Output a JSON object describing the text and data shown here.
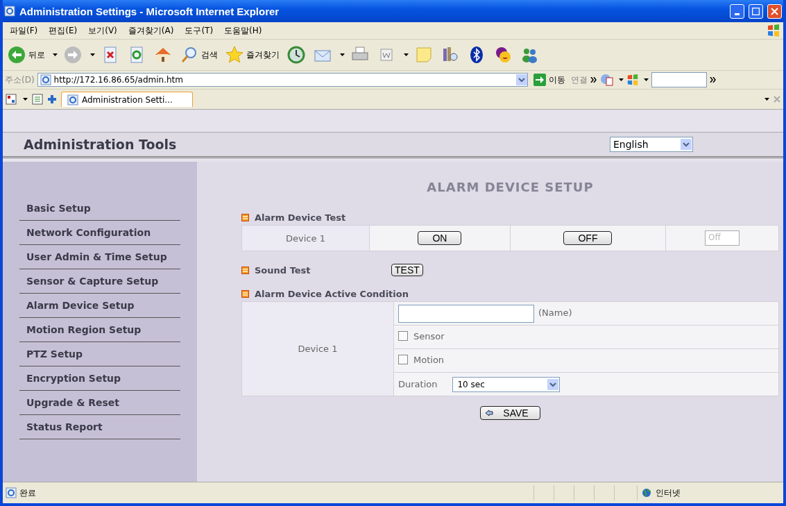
{
  "window": {
    "title": "Administration Settings - Microsoft Internet Explorer"
  },
  "menu": [
    "파일(F)",
    "편집(E)",
    "보기(V)",
    "즐겨찾기(A)",
    "도구(T)",
    "도움말(H)"
  ],
  "toolbar": [
    {
      "kind": "back",
      "label": "뒤로",
      "dropdown": true
    },
    {
      "kind": "forward",
      "dropdown": true
    },
    {
      "kind": "stop"
    },
    {
      "kind": "refresh"
    },
    {
      "kind": "home"
    },
    {
      "kind": "search",
      "label": "검색"
    },
    {
      "kind": "favorites",
      "label": "즐겨찾기"
    },
    {
      "kind": "history"
    },
    {
      "kind": "mail",
      "dropdown": true
    },
    {
      "kind": "print"
    },
    {
      "kind": "edit",
      "dropdown": true
    },
    {
      "kind": "note"
    },
    {
      "kind": "books"
    },
    {
      "kind": "bluetooth"
    },
    {
      "kind": "messenger-smile"
    },
    {
      "kind": "people"
    }
  ],
  "address": {
    "label": "주소(D)",
    "url": "http://172.16.86.65/admin.htm",
    "go": "이동",
    "links": "연결"
  },
  "tab": {
    "title": "Administration Setti..."
  },
  "page": {
    "brand": "Administration Tools",
    "language": "English",
    "sidebar": [
      "Basic Setup",
      "Network Configuration",
      "User Admin & Time Setup",
      "Sensor & Capture Setup",
      "Alarm Device Setup",
      "Motion Region Setup",
      "PTZ Setup",
      "Encryption Setup",
      "Upgrade & Reset",
      "Status Report"
    ],
    "heading": "ALARM DEVICE SETUP",
    "test": {
      "title": "Alarm Device Test",
      "device": "Device 1",
      "on": "ON",
      "off": "OFF",
      "state": "Off"
    },
    "sound": {
      "title": "Sound Test",
      "button": "TEST"
    },
    "condition": {
      "title": "Alarm Device Active Condition",
      "device": "Device 1",
      "name_hint": "(Name)",
      "options": [
        {
          "label": "Sensor",
          "checked": false
        },
        {
          "label": "Motion",
          "checked": false
        }
      ],
      "duration_label": "Duration",
      "duration": "10 sec"
    },
    "save": "SAVE"
  },
  "status_bar": {
    "text": "완료",
    "zone": "인터넷"
  }
}
